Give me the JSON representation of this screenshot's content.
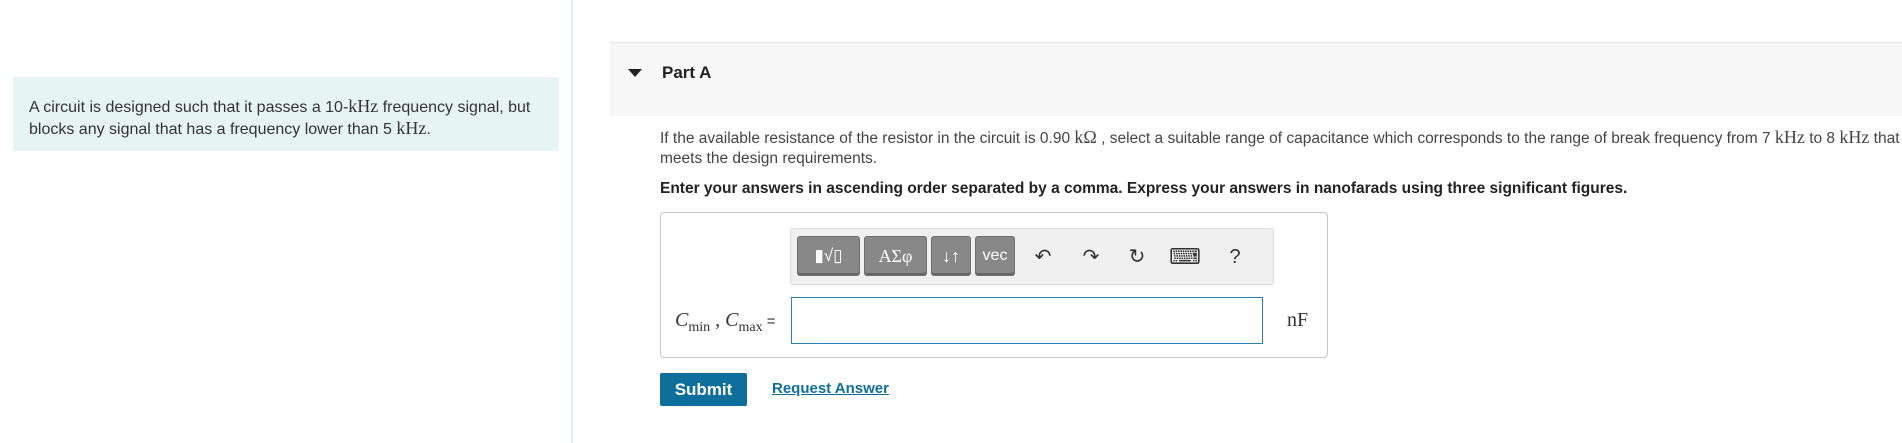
{
  "problem": {
    "text_1": "A circuit is designed such that it passes a 10-",
    "unit_khz_1": "kHz",
    "text_2": " frequency signal, but blocks any signal that has a frequency lower than 5 ",
    "unit_khz_2": "kHz",
    "text_3": "."
  },
  "part": {
    "title": "Part A"
  },
  "question": {
    "t1": "If the available resistance of the resistor in the circuit is 0.90 ",
    "u1": "kΩ",
    "t2": " , select a suitable range of capacitance which corresponds to the range of break frequency from 7 ",
    "u2": "kHz",
    "t3": " to 8 ",
    "u3": "kHz",
    "t4": " that meets the design requirements."
  },
  "instructions": "Enter your answers in ascending order separated by a comma. Express your answers in nanofarads using three significant figures.",
  "toolbar": {
    "btn_template": "▮√▯",
    "btn_greek": "ΑΣφ",
    "btn_arrows": "↓↑",
    "btn_vec": "vec",
    "undo": "↶",
    "redo": "↷",
    "reset": "↻",
    "keyboard": "⌨",
    "help": "?"
  },
  "answer": {
    "label_c1": "C",
    "label_min": "min",
    "label_sep": " , ",
    "label_c2": "C",
    "label_max": "max",
    "label_eq": " =",
    "value": "",
    "unit": "nF"
  },
  "actions": {
    "submit": "Submit",
    "request": "Request Answer"
  }
}
